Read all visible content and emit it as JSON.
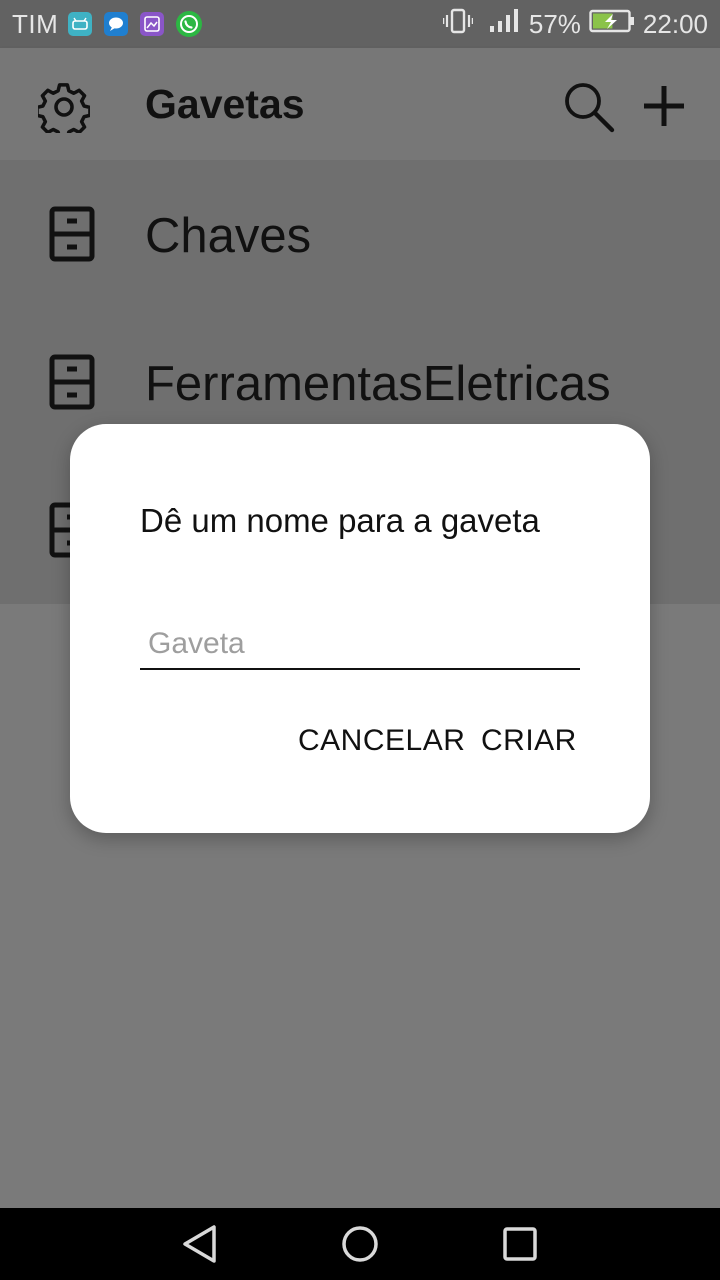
{
  "status_bar": {
    "carrier": "TIM",
    "battery_percent": "57%",
    "time": "22:00",
    "notification_icons": [
      "android-app-icon",
      "messaging-icon",
      "gallery-icon",
      "whatsapp-icon"
    ],
    "signal_bars": 4,
    "battery_level": 0.57
  },
  "app_bar": {
    "title": "Gavetas",
    "icons": [
      "settings-gear-icon",
      "search-icon",
      "add-icon"
    ]
  },
  "drawers": [
    {
      "label": "Chaves"
    },
    {
      "label": "FerramentasEletricas"
    },
    {
      "label": ""
    }
  ],
  "dialog": {
    "title": "Dê um nome para a gaveta",
    "input_placeholder": "Gaveta",
    "input_value": "",
    "cancel_label": "CANCELAR",
    "create_label": "CRIAR"
  },
  "nav_bar": {
    "icons": [
      "back-icon",
      "home-icon",
      "recents-icon"
    ]
  },
  "colors": {
    "scrim_page": "#7a7a7a",
    "dialog_bg": "#ffffff",
    "nav_bar": "#000000",
    "status_bar": "#626262"
  }
}
